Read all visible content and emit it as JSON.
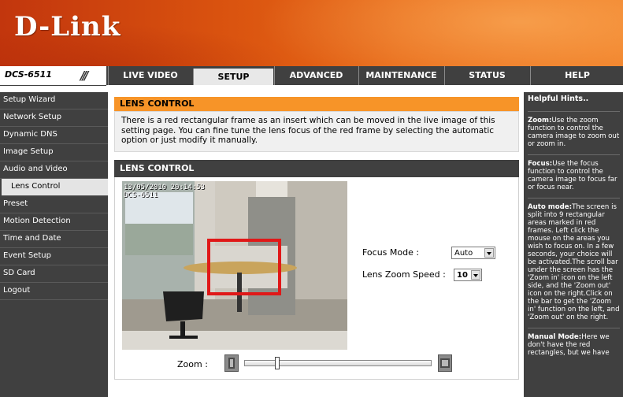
{
  "brand": {
    "logo": "D-Link"
  },
  "model": "DCS-6511",
  "nav": {
    "tabs": [
      {
        "label": "LIVE VIDEO"
      },
      {
        "label": "SETUP"
      },
      {
        "label": "ADVANCED"
      },
      {
        "label": "MAINTENANCE"
      },
      {
        "label": "STATUS"
      },
      {
        "label": "HELP"
      }
    ],
    "active": "SETUP"
  },
  "sidebar": {
    "items": [
      {
        "label": "Setup Wizard"
      },
      {
        "label": "Network Setup"
      },
      {
        "label": "Dynamic DNS"
      },
      {
        "label": "Image Setup"
      },
      {
        "label": "Audio and Video"
      },
      {
        "label": "Lens Control"
      },
      {
        "label": "Preset"
      },
      {
        "label": "Motion Detection"
      },
      {
        "label": "Time and Date"
      },
      {
        "label": "Event Setup"
      },
      {
        "label": "SD Card"
      },
      {
        "label": "Logout"
      }
    ],
    "selected": "Lens Control"
  },
  "main": {
    "section_title": "LENS CONTROL",
    "description": "There is a red rectangular frame as an insert which can be moved in the live image of this setting page. You can fine tune the lens focus of the red frame by selecting the automatic option or just modify it manually.",
    "panel_title": "LENS CONTROL",
    "video": {
      "timestamp": "13/05/2010 20:14:53",
      "camera_label": "DCS-6511"
    },
    "focus_mode": {
      "label": "Focus Mode  :",
      "value": "Auto"
    },
    "lens_zoom_speed": {
      "label": "Lens Zoom Speed  :",
      "value": "10"
    },
    "zoom": {
      "label": "Zoom :",
      "position": 0.17
    }
  },
  "hints": {
    "title": "Helpful Hints..",
    "zoom": {
      "head": "Zoom:",
      "text": "Use the zoom function to control the camera image to zoom out or zoom in."
    },
    "focus": {
      "head": "Focus:",
      "text": "Use the focus function to control the camera image to focus far or focus near."
    },
    "auto": {
      "head": "Auto mode:",
      "text": "The screen is split into 9 rectangular areas marked in red frames. Left click the mouse on the areas you wish to focus on. In a few seconds, your choice will be activated.The scroll bar under the screen has the 'Zoom in' icon on the left side, and the 'Zoom out' icon on the right.Click on the bar to get the 'Zoom in' function on the left, and 'Zoom out' on the right."
    },
    "manual": {
      "head": "Manual Mode:",
      "text": "Here we don't have the red rectangles, but we have"
    }
  },
  "colors": {
    "orange_header": "#f79428",
    "dark_bar": "#404040",
    "focus_frame": "#e01818"
  }
}
